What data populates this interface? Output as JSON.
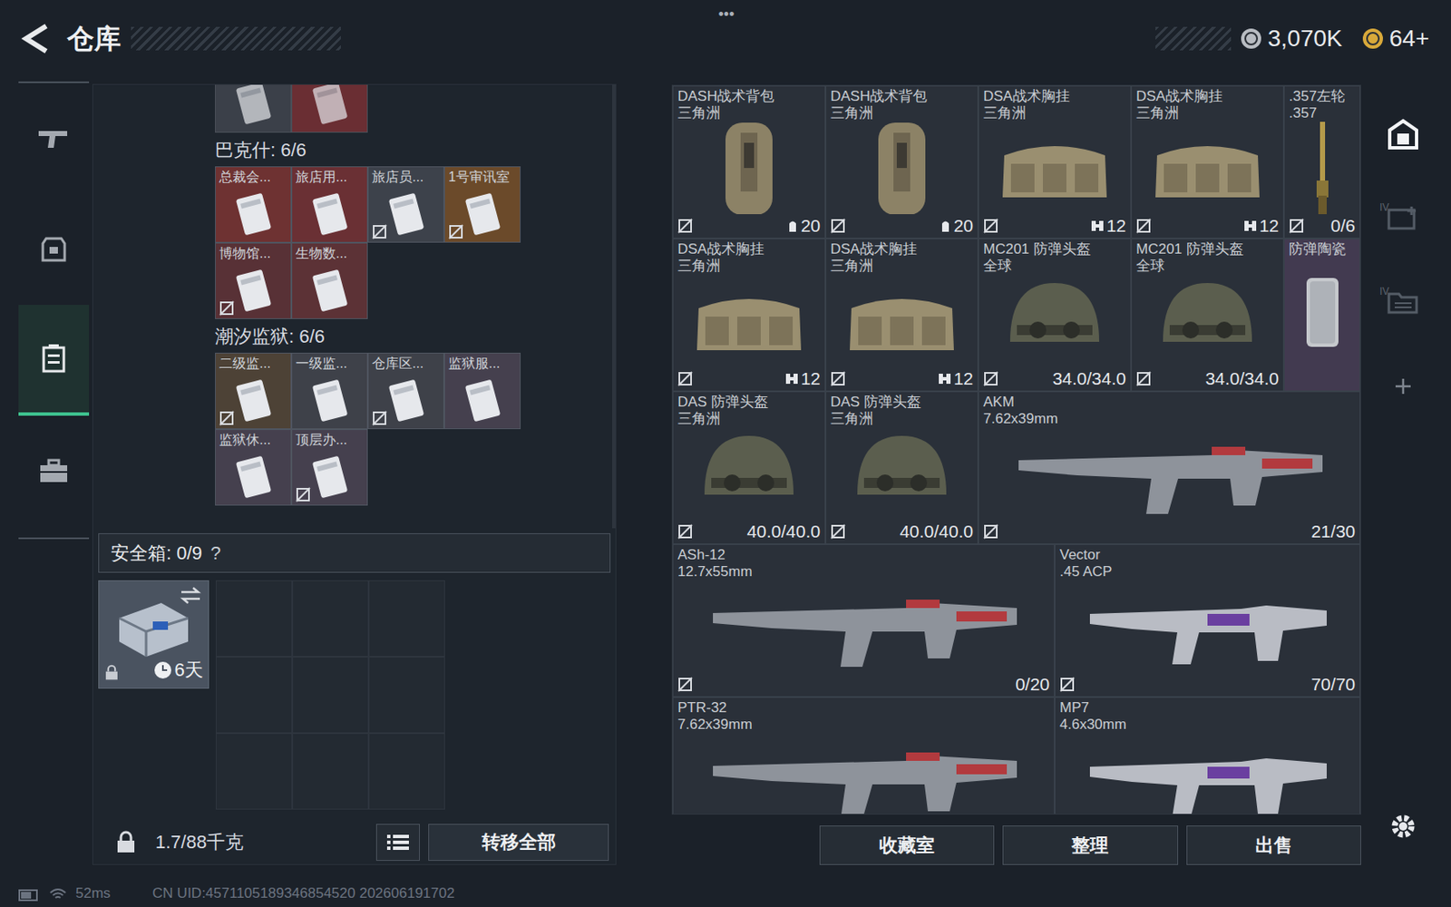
{
  "header": {
    "title": "仓库",
    "menu": "•••"
  },
  "currency": [
    {
      "value": "3,070K",
      "color": "#b8bcc2"
    },
    {
      "value": "64+",
      "color": "#d9a93a"
    }
  ],
  "nav": [
    {
      "kind": "gun",
      "selected": false
    },
    {
      "kind": "armor",
      "selected": false
    },
    {
      "kind": "stash",
      "selected": true
    },
    {
      "kind": "case",
      "selected": false
    }
  ],
  "containers": {
    "top_partial": [
      {
        "color": "#3b4049"
      },
      {
        "color": "#6a2e33"
      }
    ],
    "sections": [
      {
        "title": "巴克什: 6/6",
        "items": [
          {
            "name": "总裁会...",
            "color": "#6e3232",
            "bound": false
          },
          {
            "name": "旅店用...",
            "color": "#6a3034",
            "bound": false
          },
          {
            "name": "旅店员...",
            "color": "#3d424b",
            "bound": true
          },
          {
            "name": "1号审讯室",
            "color": "#6b4a2a",
            "bound": true
          },
          {
            "name": "博物馆...",
            "color": "#583136",
            "bound": true
          },
          {
            "name": "生物数...",
            "color": "#5c3236",
            "bound": false
          }
        ]
      },
      {
        "title": "潮汐监狱: 6/6",
        "items": [
          {
            "name": "二级监...",
            "color": "#4d4236",
            "bound": true
          },
          {
            "name": "一级监...",
            "color": "#3e4149",
            "bound": false
          },
          {
            "name": "仓库区...",
            "color": "#3e4149",
            "bound": true
          },
          {
            "name": "监狱服...",
            "color": "#45404e",
            "bound": false
          },
          {
            "name": "监狱休...",
            "color": "#45404e",
            "bound": false
          },
          {
            "name": "顶层办...",
            "color": "#45404e",
            "bound": true
          }
        ]
      }
    ]
  },
  "safe_box": {
    "title": "安全箱: 0/9",
    "help": "?",
    "item": {
      "duration": "6天",
      "locked": true
    }
  },
  "capacity": "1.7/88千克",
  "transfer_button": "转移全部",
  "stash": {
    "items": [
      {
        "name": "DASH战术背包",
        "subtitle": "三角洲",
        "stat": "20",
        "kind": "backpack",
        "bound": true,
        "color": "#2a3039"
      },
      {
        "name": "DASH战术背包",
        "subtitle": "三角洲",
        "stat": "20",
        "kind": "backpack",
        "bound": true,
        "color": "#2a3039"
      },
      {
        "name": "DSA战术胸挂",
        "subtitle": "三角洲",
        "stat": "12",
        "kind": "rig",
        "bound": true,
        "color": "#2a3039"
      },
      {
        "name": "DSA战术胸挂",
        "subtitle": "三角洲",
        "stat": "12",
        "kind": "rig",
        "bound": true,
        "color": "#2a3039"
      },
      {
        "name": ".357左轮",
        "subtitle": ".357",
        "stat": "0/6",
        "kind": "revolver",
        "bound": true,
        "color": "#2a3039"
      },
      {
        "name": "DSA战术胸挂",
        "subtitle": "三角洲",
        "stat": "12",
        "kind": "rig",
        "bound": true,
        "color": "#2a3039"
      },
      {
        "name": "DSA战术胸挂",
        "subtitle": "三角洲",
        "stat": "12",
        "kind": "rig",
        "bound": true,
        "color": "#2a3039"
      },
      {
        "name": "MC201 防弹头盔",
        "subtitle": "全球",
        "stat": "34.0/34.0",
        "kind": "helmet",
        "bound": true,
        "color": "#2a3039"
      },
      {
        "name": "MC201 防弹头盔",
        "subtitle": "全球",
        "stat": "34.0/34.0",
        "kind": "helmet",
        "bound": true,
        "color": "#2a3039"
      },
      {
        "name": "防弹陶瓷",
        "subtitle": "",
        "stat": "",
        "kind": "plate",
        "bound": false,
        "color": "#423a50"
      },
      {
        "name": "DAS 防弹头盔",
        "subtitle": "三角洲",
        "stat": "40.0/40.0",
        "kind": "helmet",
        "bound": true,
        "color": "#2a3039"
      },
      {
        "name": "DAS 防弹头盔",
        "subtitle": "三角洲",
        "stat": "40.0/40.0",
        "kind": "helmet",
        "bound": true,
        "color": "#2a3039"
      },
      {
        "name": "AKM",
        "subtitle": "7.62x39mm",
        "stat": "21/30",
        "kind": "long-rifle",
        "bound": true,
        "color": "#2a3039"
      },
      {
        "name": "ASh-12",
        "subtitle": "12.7x55mm",
        "stat": "0/20",
        "kind": "long-rifle",
        "bound": true,
        "color": "#2a3039"
      },
      {
        "name": "Vector",
        "subtitle": ".45 ACP",
        "stat": "70/70",
        "kind": "smg",
        "bound": true,
        "color": "#2a3039"
      },
      {
        "name": "PTR-32",
        "subtitle": "7.62x39mm",
        "stat": "",
        "kind": "long-rifle",
        "bound": false,
        "color": "#2a3039"
      },
      {
        "name": "MP7",
        "subtitle": "4.6x30mm",
        "stat": "",
        "kind": "smg",
        "bound": false,
        "color": "#2a3039"
      }
    ]
  },
  "rail": [
    {
      "kind": "vault",
      "selected": true,
      "badge": ""
    },
    {
      "kind": "expand",
      "selected": false,
      "badge": "IV"
    },
    {
      "kind": "files",
      "selected": false,
      "badge": "IV"
    },
    {
      "kind": "add",
      "selected": false,
      "badge": ""
    }
  ],
  "buttons": [
    "收藏室",
    "整理",
    "出售"
  ],
  "status_bar": {
    "ping": "52ms",
    "uid": "CN UID:4571105189346854520 202606191702"
  }
}
